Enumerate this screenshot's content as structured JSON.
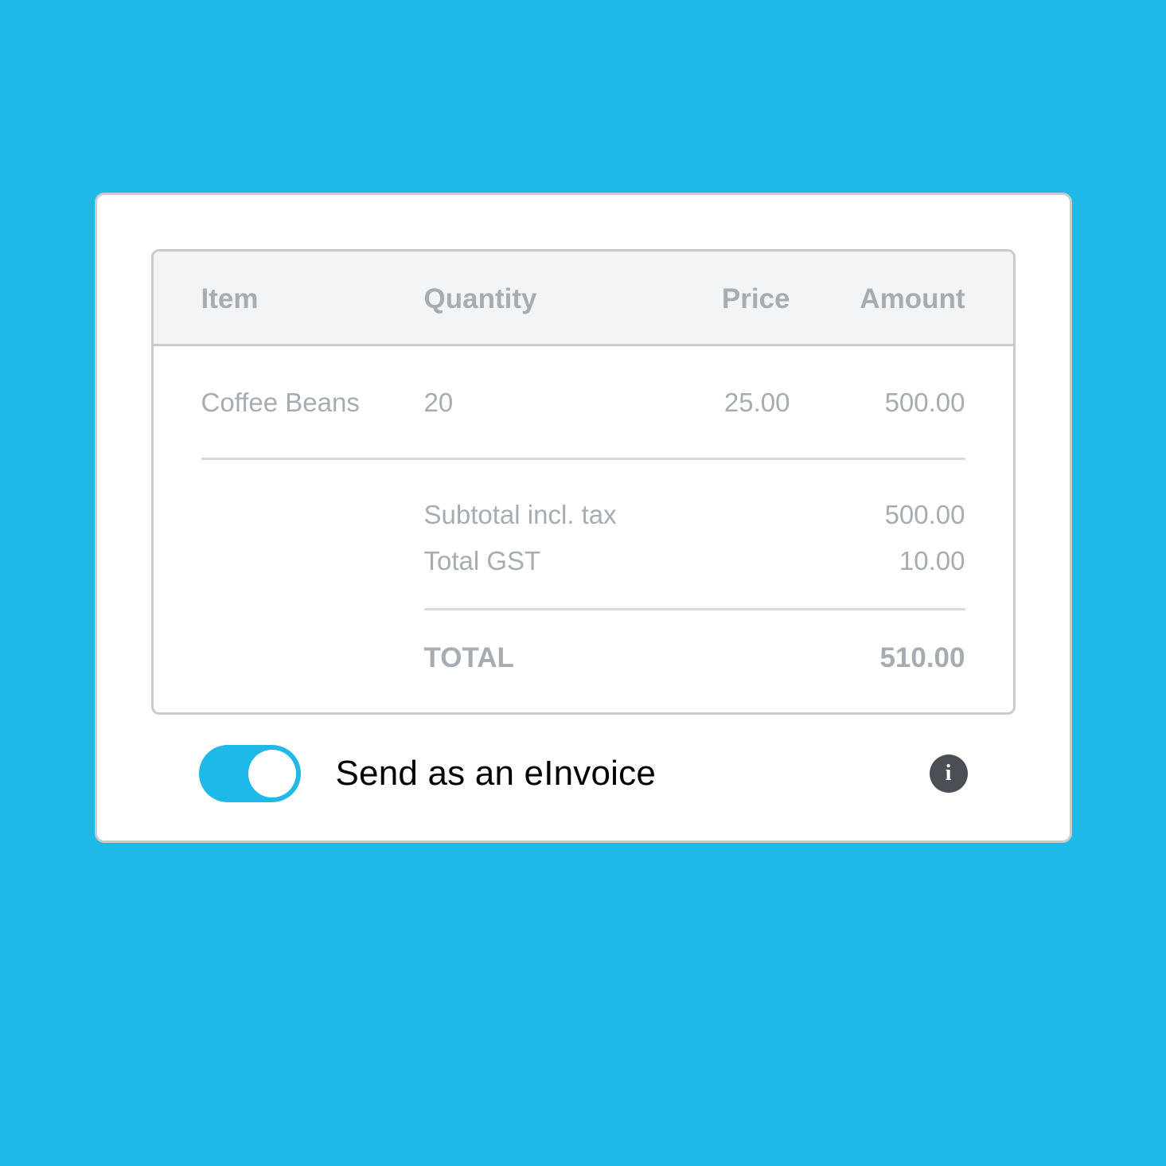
{
  "table": {
    "columns": [
      "Item",
      "Quantity",
      "Price",
      "Amount"
    ],
    "rows": [
      {
        "item": "Coffee Beans",
        "quantity": "20",
        "price": "25.00",
        "amount": "500.00"
      }
    ],
    "summary": [
      {
        "label": "Subtotal incl. tax",
        "value": "500.00"
      },
      {
        "label": "Total GST",
        "value": "10.00"
      }
    ],
    "total": {
      "label": "TOTAL",
      "value": "510.00"
    }
  },
  "footer": {
    "toggle_on": true,
    "toggle_label": "Send as an eInvoice",
    "info_glyph": "i"
  },
  "colors": {
    "bg": "#1eb9e6",
    "text_muted": "#a5adb3",
    "border": "#c8ccce"
  }
}
